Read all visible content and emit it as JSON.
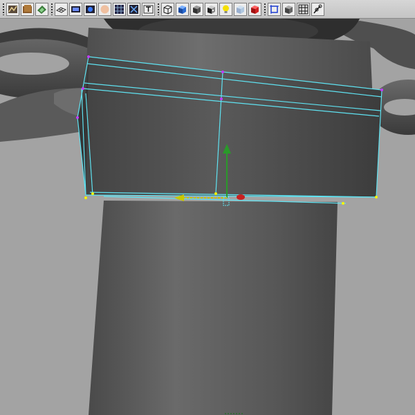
{
  "toolbar": {
    "groups": [
      [
        "graph-editor-icon",
        "hypershade-icon",
        "uv-editor-icon"
      ],
      [
        "grid-icon",
        "film-gate-icon",
        "camera-icon",
        "shaded-sphere-icon",
        "wireframe-icon",
        "resolution-gate-icon",
        "text-icon"
      ],
      [
        "wireframe-cube-icon",
        "shaded-cube-icon",
        "dark-cube-icon",
        "textured-icon",
        "light-bulb-icon",
        "xray-icon",
        "red-cube-icon"
      ],
      [
        "isolate-select-icon",
        "backface-cube-icon",
        "wireframe-on-shaded-icon",
        "joint-icon"
      ]
    ]
  },
  "colors": {
    "toolbar_bg": "#c8c8c8",
    "viewport_bg": "#a3a3a3",
    "wire": "#5fe3f2",
    "vertex_magenta": "#c23cff",
    "vertex_yellow": "#f5f500",
    "move_y_axis": "#2a9a2a",
    "move_x_axis": "#c8c800",
    "move_z_axis": "#c82020"
  }
}
